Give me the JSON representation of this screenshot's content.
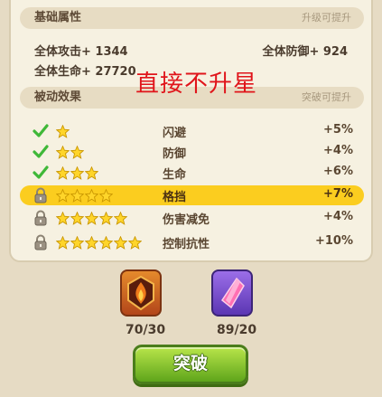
{
  "base": {
    "title": "基础属性",
    "hint": "升级可提升",
    "attack": "全体攻击+ 1344",
    "defense": "全体防御+ 924",
    "hp": "全体生命+ 27720"
  },
  "overlay_text": "直接不升星",
  "passive": {
    "title": "被动效果",
    "hint": "突破可提升",
    "rows": [
      {
        "stars": 1,
        "status": "check",
        "name": "闪避",
        "value": "+5%"
      },
      {
        "stars": 2,
        "status": "check",
        "name": "防御",
        "value": "+4%"
      },
      {
        "stars": 3,
        "status": "check",
        "name": "生命",
        "value": "+6%"
      },
      {
        "stars": 4,
        "status": "lock",
        "name": "格挡",
        "value": "+7%"
      },
      {
        "stars": 5,
        "status": "lock",
        "name": "伤害减免",
        "value": "+4%"
      },
      {
        "stars": 6,
        "status": "lock",
        "name": "控制抗性",
        "value": "+10%"
      }
    ]
  },
  "items": [
    {
      "icon": "fire-gem-icon",
      "count": "70/30"
    },
    {
      "icon": "purple-crystal-icon",
      "count": "89/20"
    }
  ],
  "button_label": "突破",
  "colors": {
    "highlight": "#fbcd1f",
    "button": "#8ccc2e",
    "overlay": "#e0151b"
  }
}
